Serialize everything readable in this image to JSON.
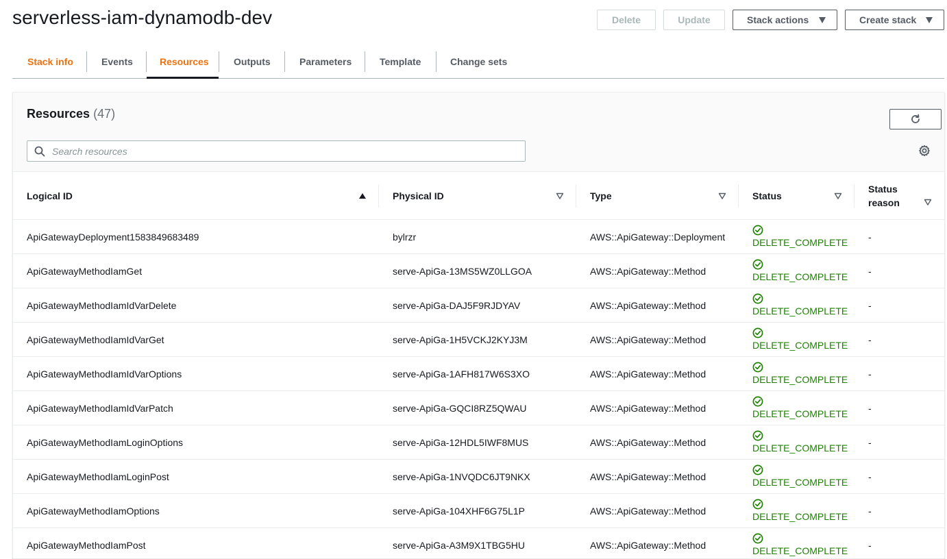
{
  "page": {
    "title": "serverless-iam-dynamodb-dev",
    "buttons": {
      "delete": "Delete",
      "update": "Update",
      "stack_actions": "Stack actions",
      "create_stack": "Create stack"
    }
  },
  "tabs": [
    {
      "label": "Stack info"
    },
    {
      "label": "Events"
    },
    {
      "label": "Resources"
    },
    {
      "label": "Outputs"
    },
    {
      "label": "Parameters"
    },
    {
      "label": "Template"
    },
    {
      "label": "Change sets"
    }
  ],
  "resources": {
    "title": "Resources",
    "count": "(47)",
    "search_placeholder": "Search resources",
    "columns": {
      "logical_id": "Logical ID",
      "physical_id": "Physical ID",
      "type": "Type",
      "status": "Status",
      "status_reason": "Status reason"
    },
    "rows": [
      {
        "logical_id": "ApiGatewayDeployment1583849683489",
        "physical_id": "bylrzr",
        "type": "AWS::ApiGateway::Deployment",
        "status": "DELETE_COMPLETE",
        "reason": "-"
      },
      {
        "logical_id": "ApiGatewayMethodIamGet",
        "physical_id": "serve-ApiGa-13MS5WZ0LLGOA",
        "type": "AWS::ApiGateway::Method",
        "status": "DELETE_COMPLETE",
        "reason": "-"
      },
      {
        "logical_id": "ApiGatewayMethodIamIdVarDelete",
        "physical_id": "serve-ApiGa-DAJ5F9RJDYAV",
        "type": "AWS::ApiGateway::Method",
        "status": "DELETE_COMPLETE",
        "reason": "-"
      },
      {
        "logical_id": "ApiGatewayMethodIamIdVarGet",
        "physical_id": "serve-ApiGa-1H5VCKJ2KYJ3M",
        "type": "AWS::ApiGateway::Method",
        "status": "DELETE_COMPLETE",
        "reason": "-"
      },
      {
        "logical_id": "ApiGatewayMethodIamIdVarOptions",
        "physical_id": "serve-ApiGa-1AFH817W6S3XO",
        "type": "AWS::ApiGateway::Method",
        "status": "DELETE_COMPLETE",
        "reason": "-"
      },
      {
        "logical_id": "ApiGatewayMethodIamIdVarPatch",
        "physical_id": "serve-ApiGa-GQCI8RZ5QWAU",
        "type": "AWS::ApiGateway::Method",
        "status": "DELETE_COMPLETE",
        "reason": "-"
      },
      {
        "logical_id": "ApiGatewayMethodIamLoginOptions",
        "physical_id": "serve-ApiGa-12HDL5IWF8MUS",
        "type": "AWS::ApiGateway::Method",
        "status": "DELETE_COMPLETE",
        "reason": "-"
      },
      {
        "logical_id": "ApiGatewayMethodIamLoginPost",
        "physical_id": "serve-ApiGa-1NVQDC6JT9NKX",
        "type": "AWS::ApiGateway::Method",
        "status": "DELETE_COMPLETE",
        "reason": "-"
      },
      {
        "logical_id": "ApiGatewayMethodIamOptions",
        "physical_id": "serve-ApiGa-104XHF6G75L1P",
        "type": "AWS::ApiGateway::Method",
        "status": "DELETE_COMPLETE",
        "reason": "-"
      },
      {
        "logical_id": "ApiGatewayMethodIamPost",
        "physical_id": "serve-ApiGa-A3M9X1TBG5HU",
        "type": "AWS::ApiGateway::Method",
        "status": "DELETE_COMPLETE",
        "reason": "-"
      }
    ]
  },
  "colors": {
    "accent": "#ec7211",
    "success": "#1d8102",
    "text": "#16191f",
    "muted": "#545b64"
  }
}
